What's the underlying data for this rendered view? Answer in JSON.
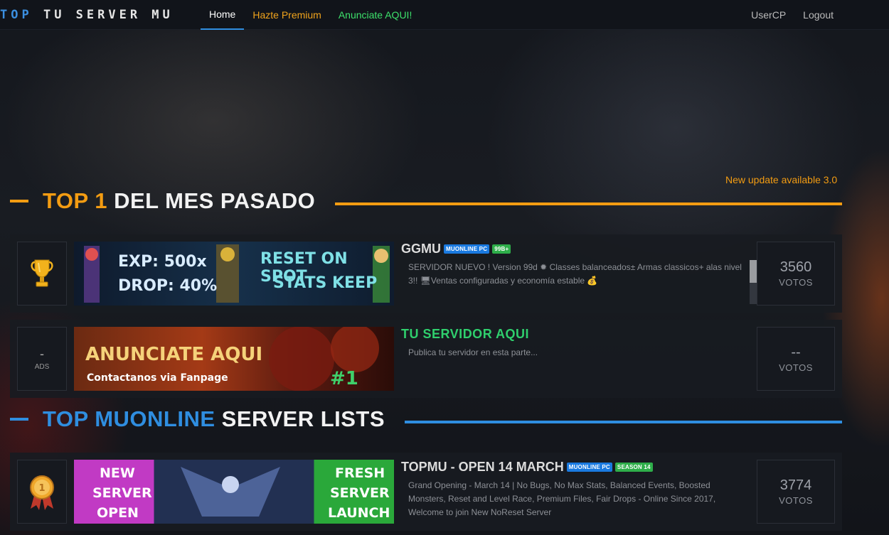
{
  "nav": {
    "brand_a": "TOP",
    "brand_b": " TU SERVER MU",
    "home": "Home",
    "premium": "Hazte Premium",
    "anunciate": "Anunciate AQUI!",
    "usercp": "UserCP",
    "logout": "Logout"
  },
  "update_note": "New update available 3.0",
  "section_top1": {
    "accent": "TOP 1",
    "rest": " DEL MES PASADO"
  },
  "section_list": {
    "accent": "TOP MUONLINE",
    "rest": " SERVER LISTS"
  },
  "rows": [
    {
      "rank_icon": "trophy-icon",
      "banner_lines": [
        "EXP: 500x",
        "DROP: 40%",
        "RESET ON SPOT",
        "STATS KEEP"
      ],
      "name": "GGMU",
      "tags": [
        "MUONLINE PC",
        "99B+"
      ],
      "desc": "SERVIDOR NUEVO ! Version 99d ✹ Classes balanceados± Armas classicos+ alas nivel 3!! 🖥Ventas configuradas y economía estable 💰",
      "votes": "3560",
      "votes_label": "VOTOS"
    },
    {
      "rank_dash": "-",
      "rank_label": "ADS",
      "banner_lines": [
        "ANUNCIATE AQUI",
        "Contactanos via Fanpage",
        "#1"
      ],
      "name": "TU SERVIDOR AQUI",
      "desc": "Publica tu servidor en esta parte...",
      "votes": "--",
      "votes_label": "VOTOS"
    },
    {
      "rank_icon": "medal-icon",
      "banner_lines": [
        "NEW",
        "SERVER",
        "OPEN",
        "FRESH",
        "SERVER",
        "LAUNCH"
      ],
      "name": "TOPMU - OPEN 14 MARCH",
      "tags": [
        "MUONLINE PC",
        "SEASON 14"
      ],
      "desc": "Grand Opening - March 14 | No Bugs, No Max Stats, Balanced Events, Boosted Monsters, Reset and Level Race, Premium Files, Fair Drops - Online Since 2017, Welcome to join New NoReset Server",
      "votes": "3774",
      "votes_label": "VOTOS"
    }
  ],
  "colors": {
    "accent_orange": "#f39c12",
    "accent_blue": "#2f8ee0",
    "promo_green": "#2fcf6d"
  }
}
